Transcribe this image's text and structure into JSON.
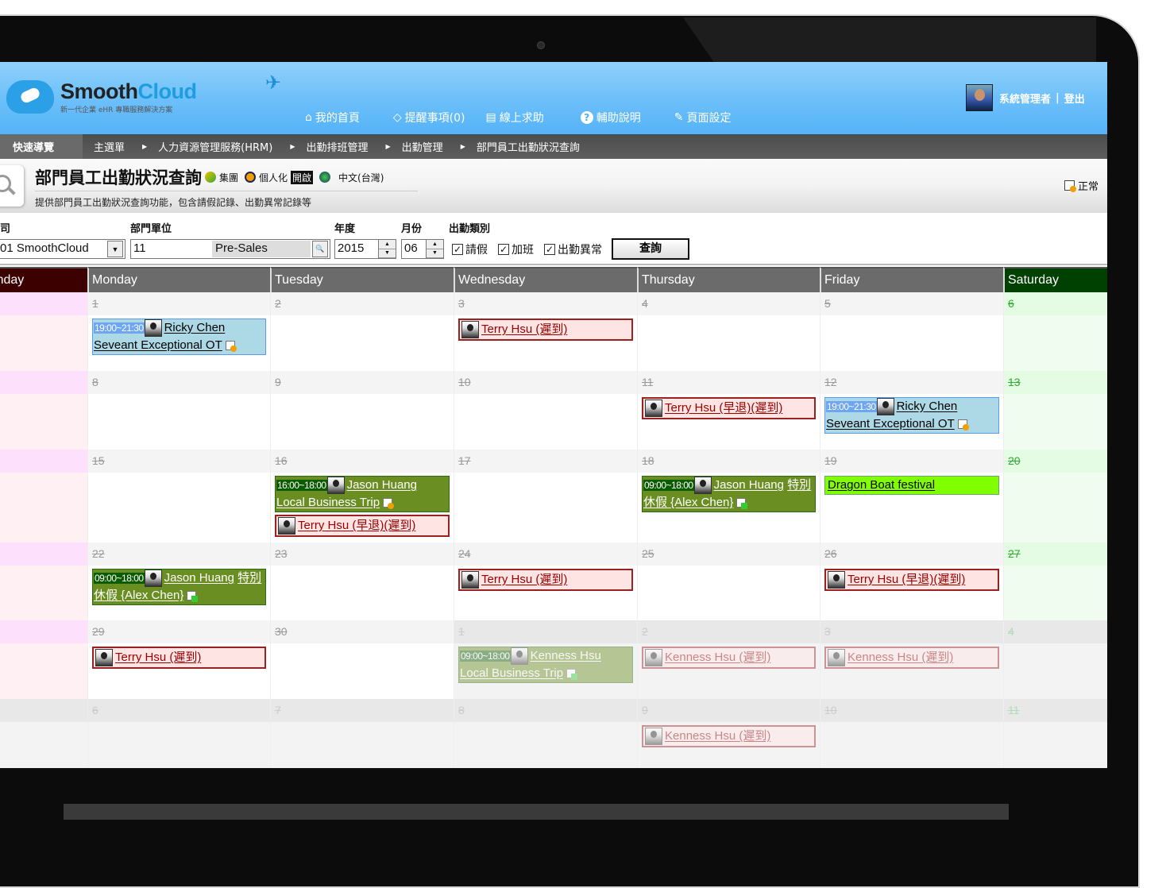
{
  "header": {
    "brand_a": "Smooth",
    "brand_b": "Cloud",
    "tagline": "新一代企業 eHR 專職服務解決方案",
    "nav": [
      {
        "icon": "home-icon",
        "glyph": "⌂",
        "label": "我的首頁"
      },
      {
        "icon": "bell-icon",
        "glyph": "◇",
        "label": "提醒事項(0)"
      },
      {
        "icon": "help-board-icon",
        "glyph": "▤",
        "label": "線上求助"
      },
      {
        "icon": "question-icon",
        "glyph": "?",
        "label": "輔助說明"
      },
      {
        "icon": "wrench-icon",
        "glyph": "✎",
        "label": "頁面設定"
      }
    ],
    "user": "系統管理者",
    "logout": "登出"
  },
  "breadcrumb": {
    "quick": "快速導覽",
    "items": [
      "主選單",
      "人力資源管理服務(HRM)",
      "出勤排班管理",
      "出勤管理",
      "部門員工出勤狀況查詢"
    ]
  },
  "page": {
    "title": "部門員工出勤狀況查詢",
    "group": "集團",
    "personal": "個人化",
    "open": "開啟",
    "lang": "中文(台灣)",
    "subtitle": "提供部門員工出勤狀況查詢功能，包含請假記錄、出勤異常記錄等",
    "status": "正常"
  },
  "filters": {
    "company_label": "司",
    "company_value": "01 SmoothCloud",
    "dept_label": "部門單位",
    "dept_code": "11",
    "dept_name": "Pre-Sales",
    "year_label": "年度",
    "year": "2015",
    "month_label": "月份",
    "month": "06",
    "type_label": "出勤類別",
    "checks": [
      {
        "label": "請假",
        "checked": true
      },
      {
        "label": "加班",
        "checked": true
      },
      {
        "label": "出勤異常",
        "checked": true
      }
    ],
    "query": "查詢"
  },
  "colors": {
    "sunday_header": "#3d0000",
    "saturday_header": "#004000",
    "weekday_header": "#6b6b6b",
    "ot": "#add8e6",
    "leave": "#6b8e23",
    "late": "#ffe4e4",
    "holiday": "#80ff00"
  },
  "calendar": {
    "days": [
      "Sunday",
      "Monday",
      "Tuesday",
      "Wednesday",
      "Thursday",
      "Friday",
      "Saturday"
    ],
    "weeks": [
      [
        {
          "day": ""
        },
        {
          "day": "1",
          "events": [
            {
              "type": "ot",
              "time": "19:00~21:30",
              "name": "Ricky Chen",
              "desc": "Seveant Exceptional OT"
            }
          ]
        },
        {
          "day": "2"
        },
        {
          "day": "3",
          "events": [
            {
              "type": "late",
              "name": "Terry Hsu (遲到)"
            }
          ]
        },
        {
          "day": "4"
        },
        {
          "day": "5"
        },
        {
          "day": "6"
        }
      ],
      [
        {
          "day": ""
        },
        {
          "day": "8"
        },
        {
          "day": "9"
        },
        {
          "day": "10"
        },
        {
          "day": "11",
          "events": [
            {
              "type": "late",
              "name": "Terry Hsu (早退)(遲到)"
            }
          ]
        },
        {
          "day": "12",
          "events": [
            {
              "type": "ot",
              "time": "19:00~21:30",
              "name": "Ricky Chen",
              "desc": "Seveant Exceptional OT"
            }
          ]
        },
        {
          "day": "13"
        }
      ],
      [
        {
          "day": ""
        },
        {
          "day": "15"
        },
        {
          "day": "16",
          "events": [
            {
              "type": "trip",
              "time": "16:00~18:00",
              "name": "Jason Huang",
              "desc": "Local Business Trip"
            },
            {
              "type": "late",
              "name": "Terry Hsu (早退)(遲到)"
            }
          ]
        },
        {
          "day": "17"
        },
        {
          "day": "18",
          "events": [
            {
              "type": "leave",
              "time": "09:00~18:00",
              "name": "Jason Huang",
              "desc": "特別休假 {Alex Chen}"
            }
          ]
        },
        {
          "day": "19",
          "events": [
            {
              "type": "holiday",
              "name": "Dragon Boat festival"
            }
          ]
        },
        {
          "day": "20"
        }
      ],
      [
        {
          "day": ""
        },
        {
          "day": "22",
          "events": [
            {
              "type": "leave",
              "time": "09:00~18:00",
              "name": "Jason Huang",
              "desc": "特別休假 {Alex Chen}"
            }
          ]
        },
        {
          "day": "23"
        },
        {
          "day": "24",
          "events": [
            {
              "type": "late",
              "name": "Terry Hsu (遲到)"
            }
          ]
        },
        {
          "day": "25"
        },
        {
          "day": "26",
          "events": [
            {
              "type": "late",
              "name": "Terry Hsu (早退)(遲到)"
            }
          ]
        },
        {
          "day": "27"
        }
      ],
      [
        {
          "day": ""
        },
        {
          "day": "29",
          "events": [
            {
              "type": "late",
              "name": "Terry Hsu (遲到)"
            }
          ]
        },
        {
          "day": "30"
        },
        {
          "day": "1",
          "other": true,
          "events": [
            {
              "type": "trip",
              "time": "09:00~18:00",
              "name": "Kenness Hsu",
              "desc": "Local Business Trip"
            }
          ]
        },
        {
          "day": "2",
          "other": true,
          "events": [
            {
              "type": "late",
              "name": "Kenness Hsu (遲到)"
            }
          ]
        },
        {
          "day": "3",
          "other": true,
          "events": [
            {
              "type": "late",
              "name": "Kenness Hsu (遲到)"
            }
          ]
        },
        {
          "day": "4",
          "other": true
        }
      ],
      [
        {
          "day": "",
          "other": true
        },
        {
          "day": "6",
          "other": true
        },
        {
          "day": "7",
          "other": true
        },
        {
          "day": "8",
          "other": true
        },
        {
          "day": "9",
          "other": true,
          "events": [
            {
              "type": "late",
              "name": "Kenness Hsu (遲到)"
            }
          ]
        },
        {
          "day": "10",
          "other": true
        },
        {
          "day": "11",
          "other": true
        }
      ]
    ]
  }
}
